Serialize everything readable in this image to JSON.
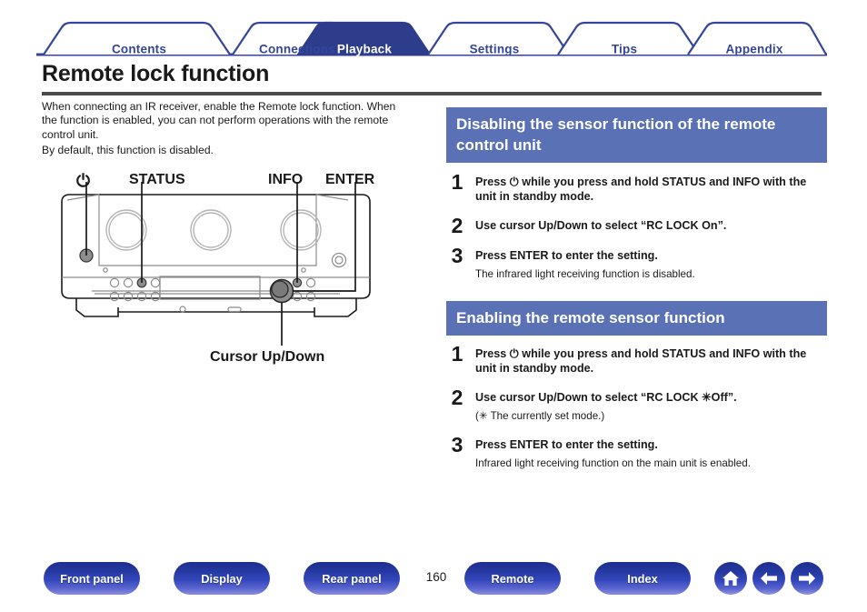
{
  "tabs": [
    {
      "label": "Contents",
      "active": false
    },
    {
      "label": "Connections",
      "active": false
    },
    {
      "label": "Playback",
      "active": true
    },
    {
      "label": "Settings",
      "active": false
    },
    {
      "label": "Tips",
      "active": false
    },
    {
      "label": "Appendix",
      "active": false
    }
  ],
  "page": {
    "title": "Remote lock function",
    "number": "160"
  },
  "intro": {
    "paragraph1": "When connecting an IR receiver, enable the Remote lock function. When the function is enabled, you can not perform operations with the remote control unit.",
    "paragraph2": "By default, this function is disabled."
  },
  "figure": {
    "power_label": "⏻",
    "status_label": "STATUS",
    "info_label": "INFO",
    "enter_label": "ENTER",
    "cursor_label": "Cursor Up/Down"
  },
  "sections": [
    {
      "header": "Disabling the sensor function of the remote control unit",
      "steps": [
        {
          "num": "1",
          "title": "Press ⏻ while you press and hold STATUS and INFO with the unit in standby mode.",
          "note": ""
        },
        {
          "num": "2",
          "title": "Use cursor Up/Down to select “RC LOCK On”.",
          "note": ""
        },
        {
          "num": "3",
          "title": "Press ENTER to enter the setting.",
          "note": "The infrared light receiving function is disabled."
        }
      ]
    },
    {
      "header": "Enabling the remote sensor function",
      "steps": [
        {
          "num": "1",
          "title": "Press ⏻ while you press and hold STATUS and INFO with the unit in standby mode.",
          "note": ""
        },
        {
          "num": "2",
          "title": "Use cursor Up/Down to select “RC LOCK ✳Off”.",
          "note": "(✳ The currently set mode.)"
        },
        {
          "num": "3",
          "title": "Press ENTER to enter the setting.",
          "note": "Infrared light receiving function on the main unit is enabled."
        }
      ]
    }
  ],
  "bottom_nav": {
    "buttons": [
      {
        "label": "Front panel"
      },
      {
        "label": "Display"
      },
      {
        "label": "Rear panel"
      },
      {
        "label": "Remote"
      },
      {
        "label": "Index"
      }
    ],
    "icons": [
      {
        "name": "home-icon"
      },
      {
        "name": "back-arrow-icon"
      },
      {
        "name": "forward-arrow-icon"
      }
    ]
  },
  "colors": {
    "tab_active_bg": "#2e3c8c",
    "tab_outline": "#34459b",
    "section_header_bg": "#5a72b5",
    "title_rule": "#4a4a4a",
    "nav_button_top": "#1d2f8f",
    "nav_button_bottom": "#8b8fdd"
  }
}
